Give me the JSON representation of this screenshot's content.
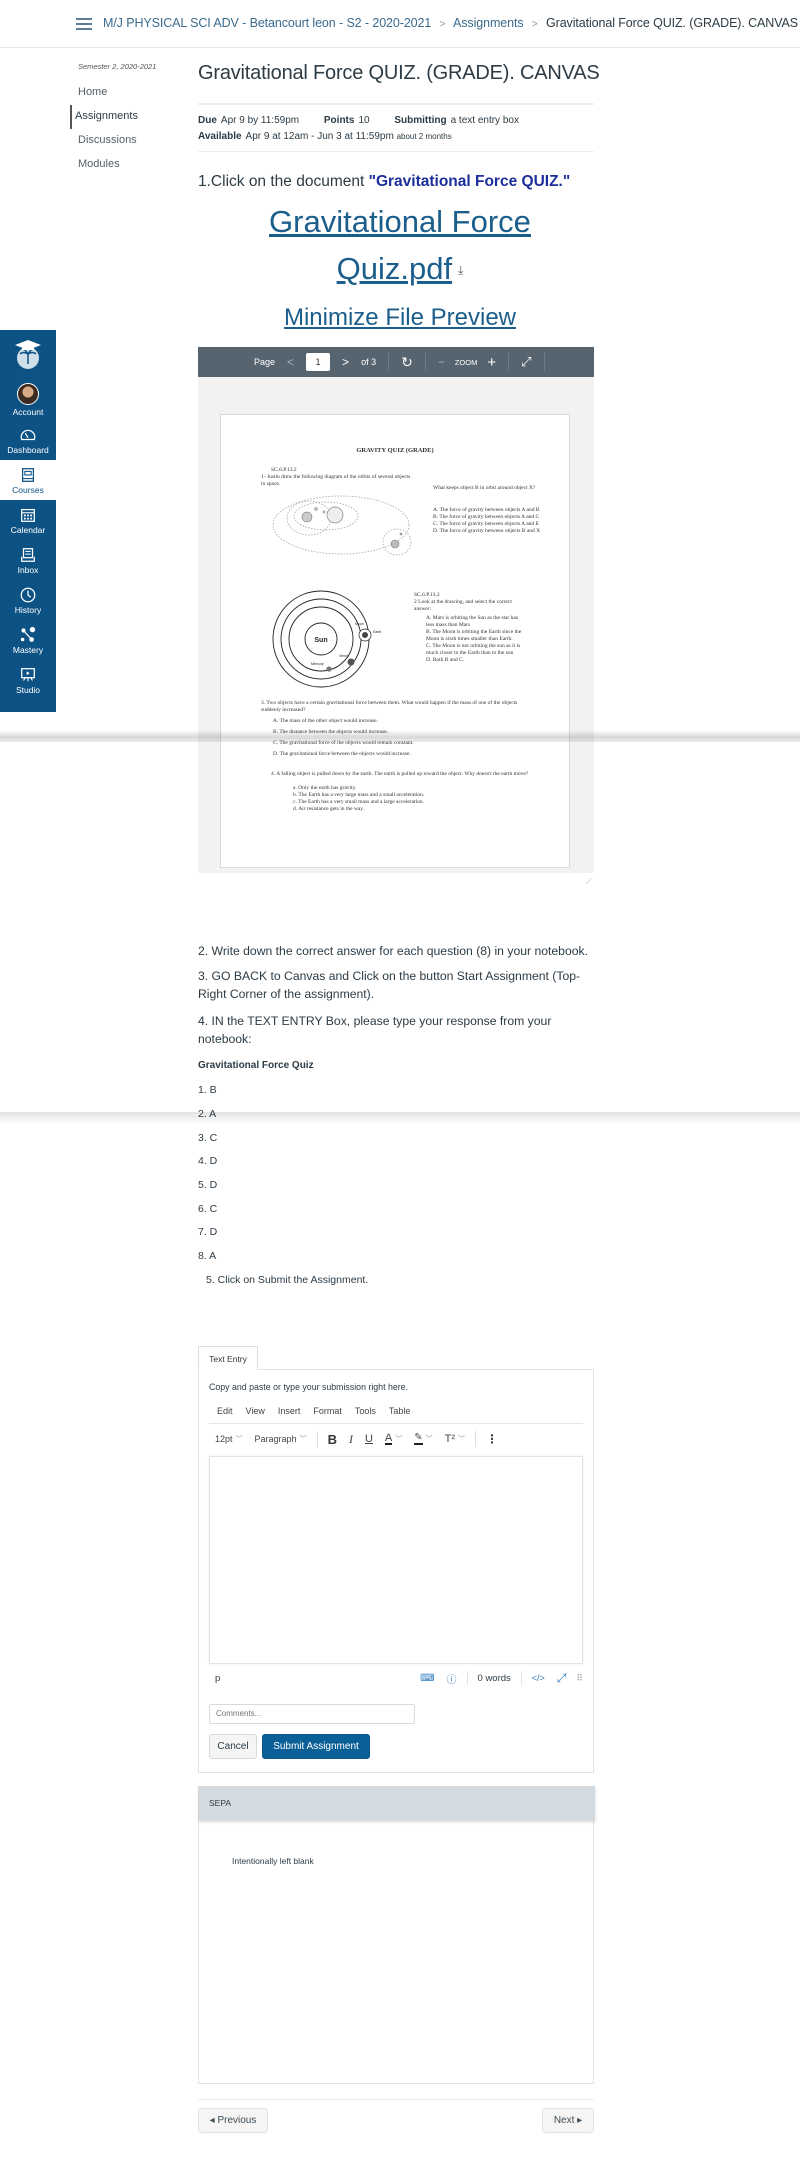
{
  "header": {
    "breadcrumbs": [
      {
        "label": "M/J PHYSICAL SCI ADV - Betancourt leon - S2 - 2020-2021"
      },
      {
        "label": "Assignments"
      },
      {
        "label": "Gravitational Force QUIZ. (GRADE). CANVAS"
      }
    ]
  },
  "course_nav": {
    "term": "Semester 2, 2020-2021",
    "items": [
      {
        "label": "Home",
        "active": false
      },
      {
        "label": "Assignments",
        "active": true
      },
      {
        "label": "Discussions",
        "active": false
      },
      {
        "label": "Modules",
        "active": false
      }
    ]
  },
  "global_nav": {
    "items": [
      {
        "label": "Account",
        "icon": "avatar"
      },
      {
        "label": "Dashboard",
        "icon": "dashboard-icon"
      },
      {
        "label": "Courses",
        "icon": "courses-icon",
        "active": true
      },
      {
        "label": "Calendar",
        "icon": "calendar-icon"
      },
      {
        "label": "Inbox",
        "icon": "inbox-icon"
      },
      {
        "label": "History",
        "icon": "history-icon"
      },
      {
        "label": "Mastery",
        "icon": "mastery-icon"
      },
      {
        "label": "Studio",
        "icon": "studio-icon"
      }
    ]
  },
  "assignment": {
    "title": "Gravitational Force QUIZ. (GRADE). CANVAS",
    "due_label": "Due",
    "due_value": "Apr 9 by 11:59pm",
    "points_label": "Points",
    "points_value": "10",
    "submitting_label": "Submitting",
    "submitting_value": "a text entry box",
    "available_label": "Available",
    "available_value": "Apr 9 at 12am - Jun 3 at 11:59pm",
    "available_note": "about 2 months"
  },
  "instructions": {
    "step1_prefix": "1.Click on the document ",
    "step1_quote": "\"Gravitational Force QUIZ.\"",
    "file_link_line1": "Gravitational Force",
    "file_link_line2": "Quiz.pdf",
    "minimize_link": "Minimize File Preview",
    "step2": "2. Write down the correct answer for each question (8) in your notebook.",
    "step3": "3. GO BACK  to Canvas and Click on the button Start Assignment (Top-Right Corner of the assignment).",
    "step4": "4. IN the TEXT ENTRY Box, please type your response from your notebook:",
    "quiz_heading": "Gravitational Force Quiz",
    "answers": [
      "1. B",
      "2. A",
      "3. C",
      "4. D",
      "5. D",
      "6. C",
      "7. D",
      "8. A"
    ],
    "step5": "5. Click on Submit the Assignment."
  },
  "pdf_viewer": {
    "page_label": "Page",
    "current_page": "1",
    "total_pages_label": "of 3",
    "zoom_label": "ZOOM",
    "document": {
      "title": "GRAVITY QUIZ (GRADE)",
      "q1_code": "SC.6.P.13.2",
      "q1_text": "1- Justin drew the following diagram of the orbits of several objects in space.",
      "q1_question": "What keeps object B in orbit around object X?",
      "q1_options": [
        "A. The force of gravity between objects A and B",
        "B. The force of gravity between objects A and C",
        "C. The force of gravity between objects A and E",
        "D. The force of gravity between objects B and X"
      ],
      "q2_code": "SC.6.P.13.2",
      "q2_text": "2 Look at the drawing, and select the correct answer:",
      "q2_options": [
        "A. Mars is orbiting the Sun as the star has less mass than Mars",
        "B. The Moon is orbiting the Earth since the Moon is sixth times smaller than Earth.",
        "C. The Moon is not orbiting the sun as it is much closer to the Earth than to the sun",
        "D. Both B and C."
      ],
      "diagram_labels": {
        "sun": "Sun",
        "earth": "Earth",
        "moon": "Moon",
        "venus": "Venus",
        "mercury": "Mercury"
      },
      "q3_text": "3. Two objects have a certain gravitational force between them. What would happen if the mass of one of the objects suddenly increased?",
      "q3_options": [
        "A. The mass of the other object would increase.",
        "B. The distance between the objects would increase.",
        "C. The gravitational force of the objects would remain constant.",
        "D. The gravitational force between the objects would increase."
      ],
      "q4_text": "4.  A falling object is pulled down by the earth. The earth is pulled up toward the object. Why doesn't the earth move?",
      "q4_options": [
        "a.   Only the earth has gravity.",
        "b.   The Earth has a very large mass and a small acceleration.",
        "c.   The Earth has a very small mass and a large acceleration.",
        "d.   Air resistance gets in the way."
      ]
    }
  },
  "submission": {
    "tab_label": "Text Entry",
    "hint": "Copy and paste or type your submission right here.",
    "menu": [
      "Edit",
      "View",
      "Insert",
      "Format",
      "Tools",
      "Table"
    ],
    "font_size": "12pt",
    "block_format": "Paragraph",
    "status_path": "p",
    "word_count": "0 words",
    "comments_placeholder": "Comments...",
    "cancel_label": "Cancel",
    "submit_label": "Submit Assignment"
  },
  "sepa": {
    "header": "SEPA",
    "body": "Intentionally left blank"
  },
  "footer_nav": {
    "previous_label": "◂ Previous",
    "next_label": "Next ▸"
  },
  "colors": {
    "brand_nav": "#0d5285",
    "link": "#1b5e8c",
    "primary_button": "#0b5f97",
    "pdf_toolbar": "#56646f",
    "sepa_header": "#d3dbe1"
  }
}
